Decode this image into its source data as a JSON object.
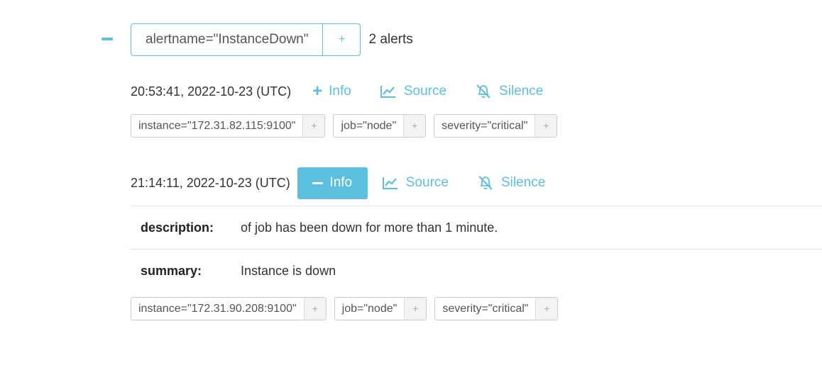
{
  "group": {
    "collapse_icon": "minus-icon",
    "label": "alertname=\"InstanceDown\"",
    "add_label": "+",
    "count_text": "2 alerts"
  },
  "alerts": [
    {
      "time": "20:53:41, 2022-10-23 (UTC)",
      "info_label": "Info",
      "info_expanded": false,
      "source_label": "Source",
      "silence_label": "Silence",
      "labels": [
        {
          "text": "instance=\"172.31.82.115:9100\"",
          "add": "+"
        },
        {
          "text": "job=\"node\"",
          "add": "+"
        },
        {
          "text": "severity=\"critical\"",
          "add": "+"
        }
      ]
    },
    {
      "time": "21:14:11, 2022-10-23 (UTC)",
      "info_label": "Info",
      "info_expanded": true,
      "source_label": "Source",
      "silence_label": "Silence",
      "annotations": [
        {
          "key": "description:",
          "value": "of job has been down for more than 1 minute."
        },
        {
          "key": "summary:",
          "value": "Instance is down"
        }
      ],
      "labels": [
        {
          "text": "instance=\"172.31.90.208:9100\"",
          "add": "+"
        },
        {
          "text": "job=\"node\"",
          "add": "+"
        },
        {
          "text": "severity=\"critical\"",
          "add": "+"
        }
      ]
    }
  ],
  "icons": {
    "source": "chart-line-icon",
    "silence": "bell-slash-icon"
  },
  "colors": {
    "accent": "#5bc0de",
    "chip_border": "#cccccc",
    "chip_add_bg": "#f3f3f3"
  }
}
